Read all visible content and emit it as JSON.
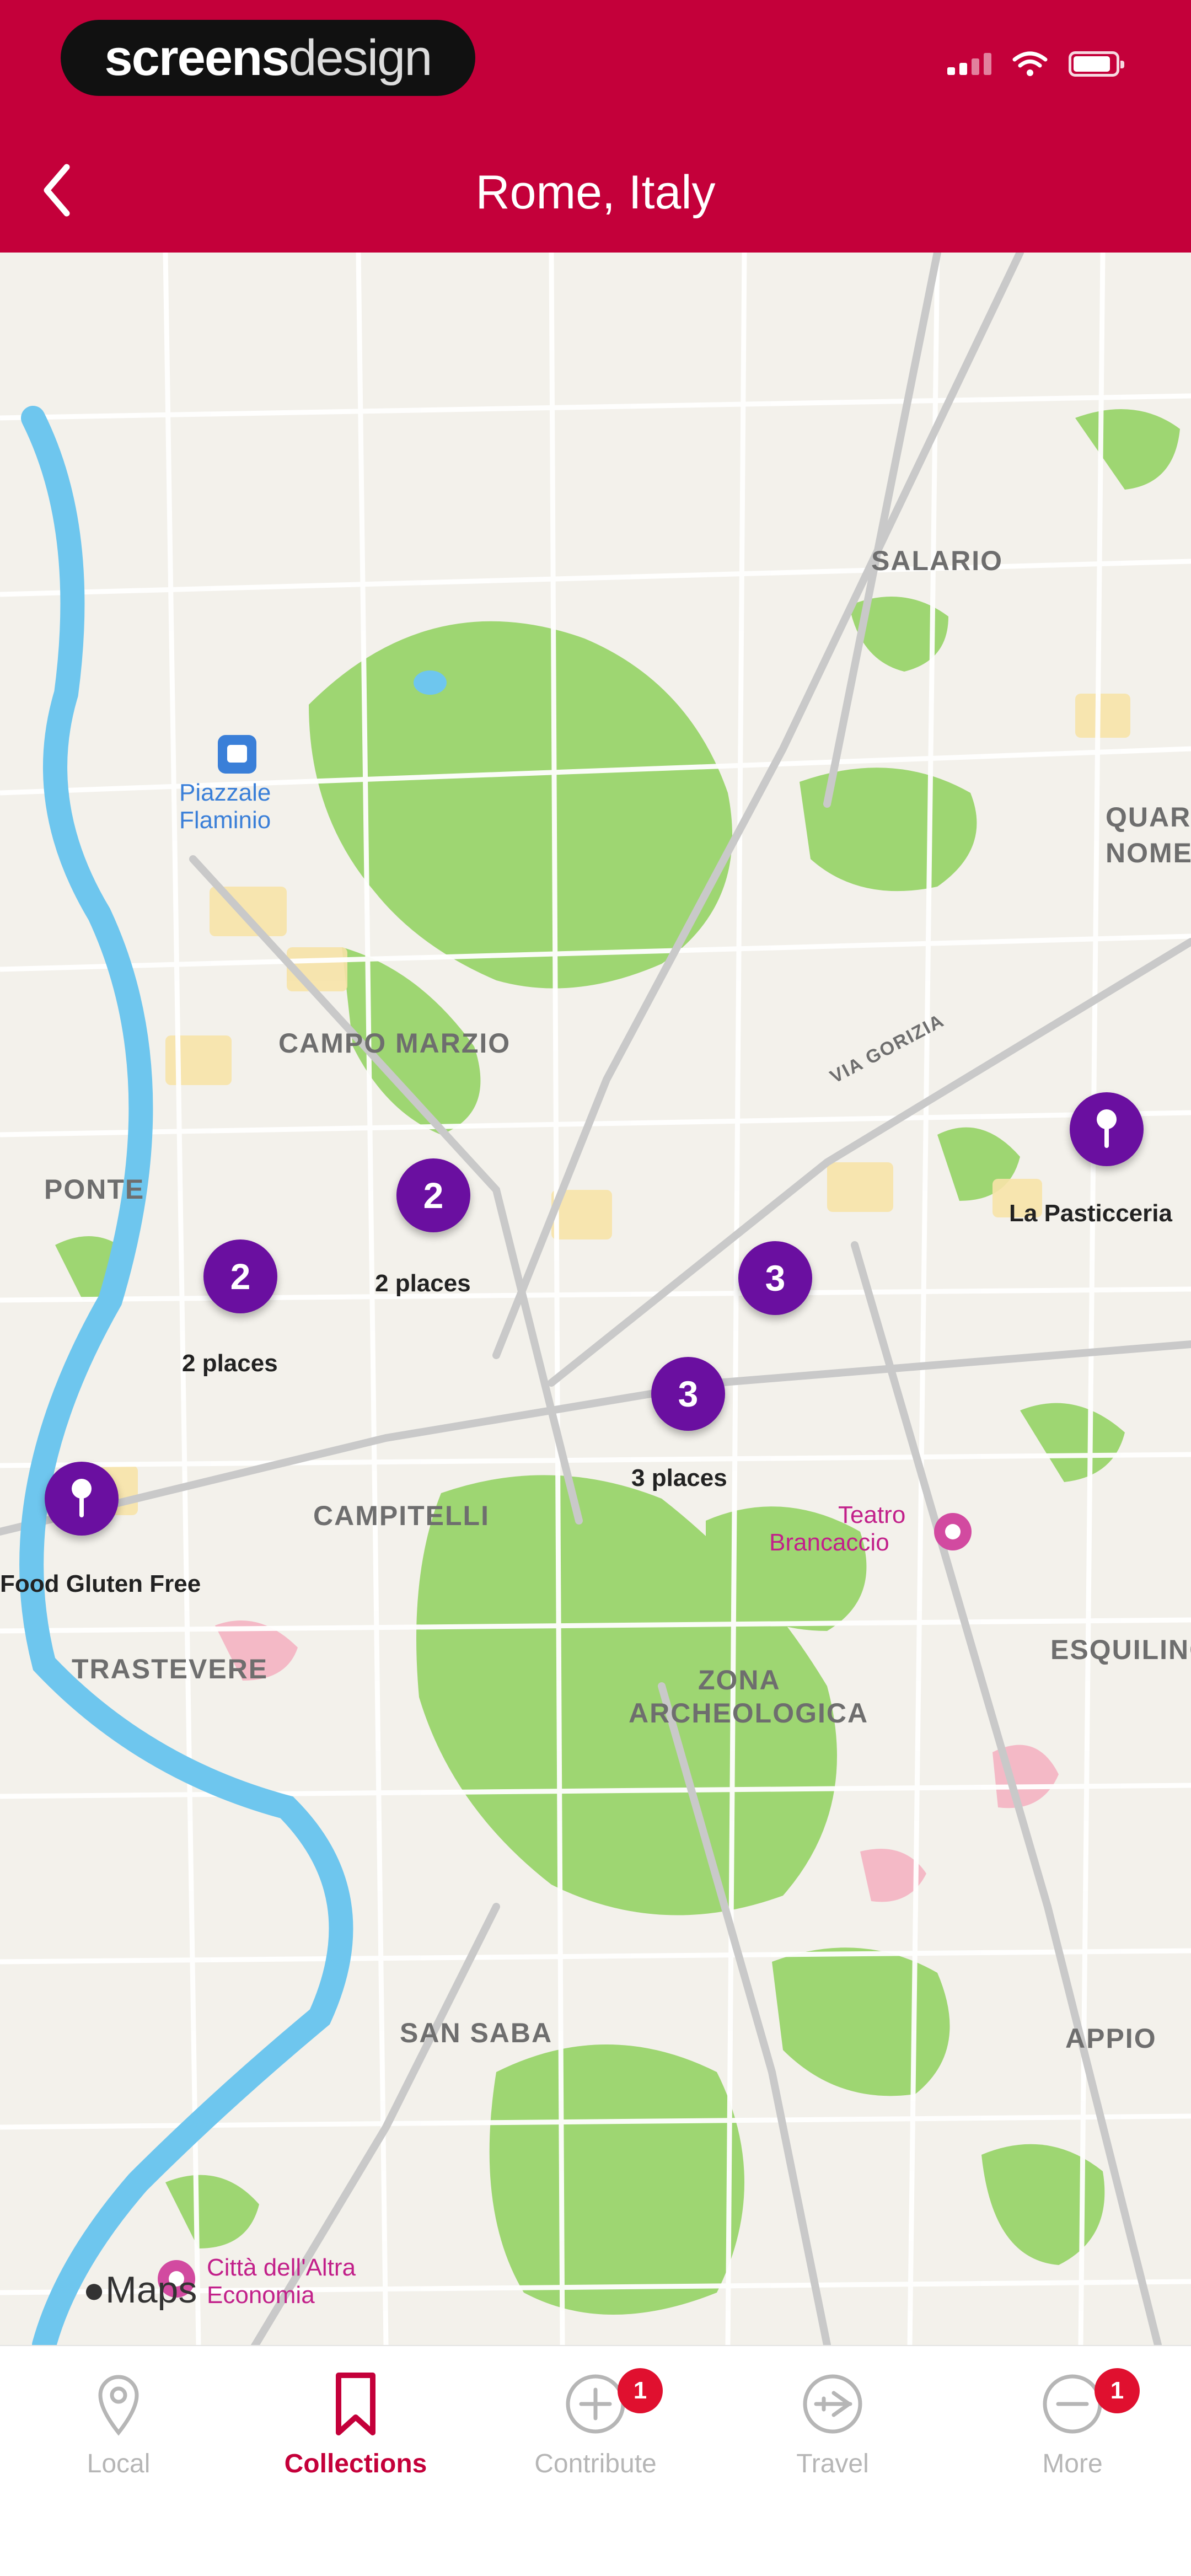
{
  "watermark": {
    "part1": "screens",
    "part2": "design"
  },
  "header": {
    "title": "Rome, Italy"
  },
  "map": {
    "districts": [
      {
        "id": "salario",
        "text": "SALARIO"
      },
      {
        "id": "campo_marzio",
        "text": "CAMPO MARZIO"
      },
      {
        "id": "ponte",
        "text": "PONTE"
      },
      {
        "id": "campitelli",
        "text": "CAMPITELLI"
      },
      {
        "id": "trastevere",
        "text": "TRASTEVERE"
      },
      {
        "id": "zona_archeologica_1",
        "text": "ZONA"
      },
      {
        "id": "zona_archeologica_2",
        "text": "ARCHEOLOGICA"
      },
      {
        "id": "san_saba",
        "text": "SAN SABA"
      },
      {
        "id": "esquilino",
        "text": "ESQUILINO"
      },
      {
        "id": "appio",
        "text": "APPIO"
      },
      {
        "id": "quartiere",
        "text": "QUAR"
      },
      {
        "id": "quartiere2",
        "text": "NOME"
      },
      {
        "id": "via_nomentana",
        "text": "VIA GORIZIA"
      }
    ],
    "pois": {
      "piazzale_flaminio_1": "Piazzale",
      "piazzale_flaminio_2": "Flaminio",
      "teatro_1": "Teatro",
      "teatro_2": "Brancaccio",
      "citta_1": "Città dell'Altra",
      "citta_2": "Economia"
    },
    "clusters": [
      {
        "id": "c1",
        "count": "2",
        "sub": "2 places"
      },
      {
        "id": "c2",
        "count": "2",
        "sub": "2 places"
      },
      {
        "id": "c3",
        "count": "3",
        "sub": ""
      },
      {
        "id": "c4",
        "count": "3",
        "sub": "3 places"
      }
    ],
    "pins": [
      {
        "id": "p1",
        "label": "La Pasticceria"
      },
      {
        "id": "p2",
        "label": "Food Gluten Free"
      }
    ],
    "maps_attribution": "Maps"
  },
  "tabbar": {
    "tabs": [
      {
        "id": "local",
        "label": "Local",
        "icon": "location-pin-icon",
        "badge": ""
      },
      {
        "id": "collections",
        "label": "Collections",
        "icon": "bookmark-icon",
        "badge": ""
      },
      {
        "id": "contribute",
        "label": "Contribute",
        "icon": "plus-circle-icon",
        "badge": "1"
      },
      {
        "id": "travel",
        "label": "Travel",
        "icon": "plane-circle-icon",
        "badge": ""
      },
      {
        "id": "more",
        "label": "More",
        "icon": "more-circle-icon",
        "badge": "1"
      }
    ],
    "active": "collections"
  },
  "colors": {
    "brand": "#c4003a",
    "pin": "#6a0fa0",
    "badge": "#e0102f",
    "park": "#9ed672",
    "water": "#6ec6ee"
  }
}
